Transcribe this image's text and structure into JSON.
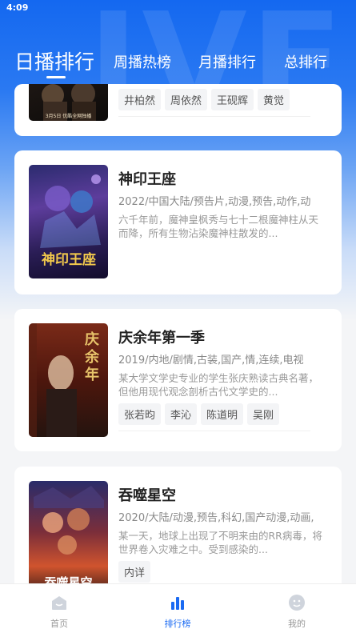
{
  "status_bar": {
    "time": "4:09"
  },
  "tabs": [
    {
      "label": "日播排行",
      "active": true
    },
    {
      "label": "周播热榜",
      "active": false
    },
    {
      "label": "月播排行",
      "active": false
    },
    {
      "label": "总排行",
      "active": false
    }
  ],
  "items": [
    {
      "poster_caption": "3月5日 优酷全网独播",
      "tags": [
        "井柏然",
        "周依然",
        "王砚辉",
        "黄觉"
      ]
    },
    {
      "title": "神印王座",
      "meta": "2022/中国大陆/预告片,动漫,预告,动作,动",
      "desc": "六千年前，魔神皇枫秀与七十二根魔神柱从天而降，所有生物沾染魔神柱散发的...",
      "poster_text": "神印王座",
      "tags": []
    },
    {
      "title": "庆余年第一季",
      "meta": "2019/内地/剧情,古装,国产,情,连续,电视",
      "desc": "某大学文学史专业的学生张庆熟读古典名著，但他用现代观念剖析古代文学史的...",
      "poster_text": "庆余年",
      "tags": [
        "张若昀",
        "李沁",
        "陈道明",
        "吴刚"
      ]
    },
    {
      "title": "吞噬星空",
      "meta": "2020/大陆/动漫,预告,科幻,国产动漫,动画,",
      "desc": "某一天，地球上出现了不明来由的RR病毒，将世界卷入灾难之中。受到感染的...",
      "poster_text": "吞噬星空",
      "tags": [
        "内详"
      ]
    }
  ],
  "bottom_nav": [
    {
      "label": "首页",
      "icon": "home-icon",
      "active": false
    },
    {
      "label": "排行榜",
      "icon": "ranking-icon",
      "active": true
    },
    {
      "label": "我的",
      "icon": "profile-icon",
      "active": false
    }
  ],
  "colors": {
    "accent": "#1a6af2",
    "header_blue": "#1468f0"
  }
}
